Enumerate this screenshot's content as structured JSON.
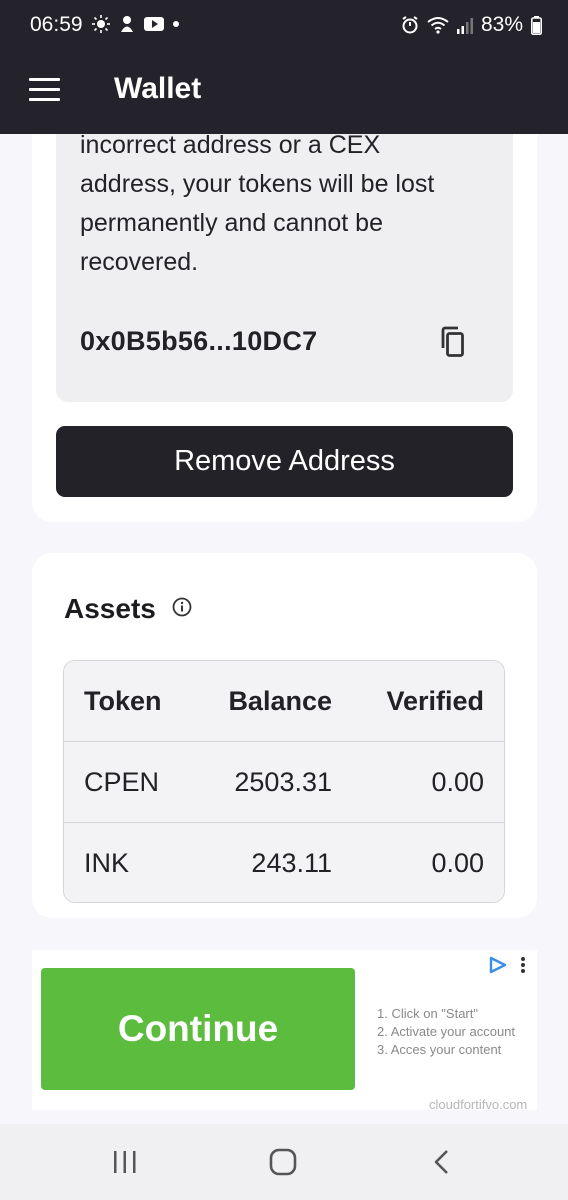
{
  "status_bar": {
    "time": "06:59",
    "battery": "83%"
  },
  "app_bar": {
    "title": "Wallet"
  },
  "warning": {
    "lines": [
      "incorrect address or a CEX",
      "address, your tokens will be lost",
      "permanently and cannot be",
      "recovered."
    ],
    "address": "0x0B5b56...10DC7"
  },
  "remove_button": {
    "label": "Remove Address"
  },
  "assets": {
    "title": "Assets",
    "headers": [
      "Token",
      "Balance",
      "Verified"
    ],
    "rows": [
      {
        "token": "CPEN",
        "balance": "2503.31",
        "verified": "0.00"
      },
      {
        "token": "INK",
        "balance": "243.11",
        "verified": "0.00"
      }
    ]
  },
  "ad": {
    "button_label": "Continue",
    "steps": [
      "1. Click on \"Start\"",
      "2. Activate your account",
      "3. Acces your content"
    ],
    "domain": "cloudfortifvo.com"
  },
  "colors": {
    "bar": "#24232b",
    "accent": "#5cbc3d",
    "button_dark": "#232228"
  }
}
